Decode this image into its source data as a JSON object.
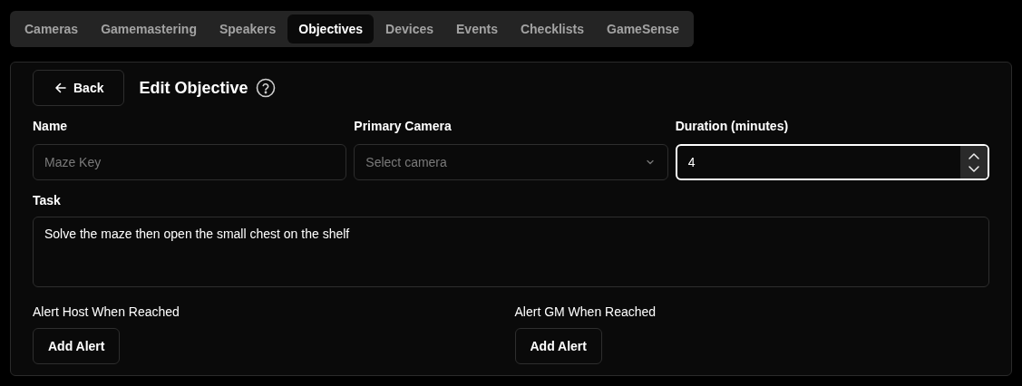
{
  "tabs": [
    {
      "label": "Cameras",
      "selected": false
    },
    {
      "label": "Gamemastering",
      "selected": false
    },
    {
      "label": "Speakers",
      "selected": false
    },
    {
      "label": "Objectives",
      "selected": true
    },
    {
      "label": "Devices",
      "selected": false
    },
    {
      "label": "Events",
      "selected": false
    },
    {
      "label": "Checklists",
      "selected": false
    },
    {
      "label": "GameSense",
      "selected": false
    }
  ],
  "header": {
    "back_button": "Back",
    "title": "Edit Objective"
  },
  "fields": [
    {
      "kind": "text",
      "label": "Name",
      "placeholder": "Maze Key",
      "focused": false
    },
    {
      "kind": "select",
      "label": "Primary Camera",
      "placeholder": "Select camera",
      "focused": false
    },
    {
      "kind": "number",
      "label": "Duration (minutes)",
      "value": "4",
      "focused": true
    }
  ],
  "task": {
    "label": "Task",
    "value": "Solve the maze then open the small chest on the shelf"
  },
  "alerts": [
    {
      "label": "Alert Host When Reached",
      "button": "Add Alert"
    },
    {
      "label": "Alert GM When Reached",
      "button": "Add Alert"
    }
  ]
}
